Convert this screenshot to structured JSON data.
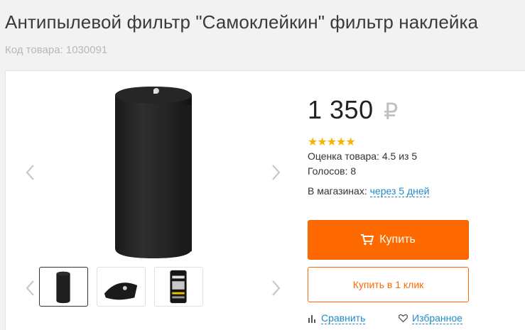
{
  "product": {
    "title": "Антипылевой фильтр \"Самоклейкин\" фильтр наклейка",
    "sku": "Код товара: 1030091"
  },
  "price": {
    "amount": "1 350",
    "currency": "₽"
  },
  "rating": {
    "stars": "★★★★★",
    "score_text": "Оценка товара: 4.5 из 5",
    "votes_text": "Голосов: 8",
    "value": 4.5,
    "max": 5,
    "star_color": "#f5b400"
  },
  "availability": {
    "label": "В магазинах:",
    "value": "через 5 дней"
  },
  "buttons": {
    "buy_label": "Купить",
    "one_click_label": "Купить в 1 клик",
    "compare_label": "Сравнить",
    "favorite_label": "Избранное"
  },
  "icons": {
    "prev": "chevron-left-icon",
    "next": "chevron-right-icon",
    "cart": "cart-icon",
    "compare": "bar-chart-icon",
    "favorite": "heart-icon"
  },
  "colors": {
    "accent": "#ff6a00",
    "link": "#1f8acb"
  }
}
